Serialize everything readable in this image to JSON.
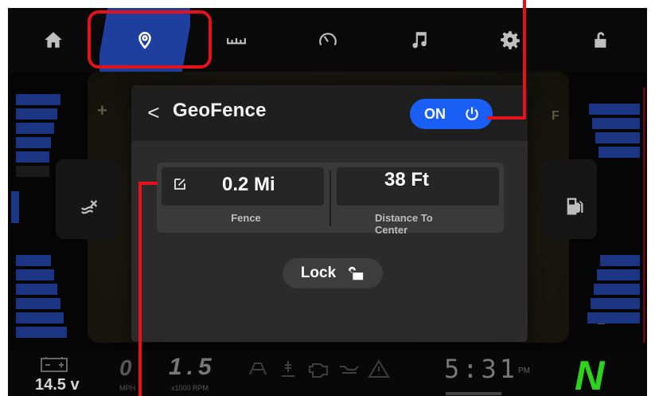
{
  "nav": {
    "tabs": [
      {
        "name": "home-icon",
        "active": false
      },
      {
        "name": "location-pin-icon",
        "active": true
      },
      {
        "name": "ruler-icon",
        "active": false
      },
      {
        "name": "speedometer-icon",
        "active": false
      },
      {
        "name": "music-note-icon",
        "active": false
      },
      {
        "name": "gear-icon",
        "active": false
      },
      {
        "name": "unlock-icon",
        "active": false
      }
    ]
  },
  "map": {
    "plus": "+",
    "full_mark": "F",
    "empty_mark": "E"
  },
  "geofence": {
    "title": "GeoFence",
    "back_glyph": "<",
    "toggle_label": "ON",
    "fence_value": "0.2 Mi",
    "fence_caption": "Fence",
    "distance_value": "38 Ft",
    "distance_caption": "Distance To Center",
    "lock_label": "Lock"
  },
  "status": {
    "voltage": "14.5 v",
    "speed": "0",
    "speed_unit": "MPH",
    "rpm": "1.5",
    "rpm_unit": "x1000 RPM",
    "time": "5:31",
    "ampm": "PM",
    "gear": "N"
  },
  "colors": {
    "accent_blue": "#1a5ff5",
    "highlight_red": "#e5121d",
    "gear_green": "#2fd11f"
  }
}
